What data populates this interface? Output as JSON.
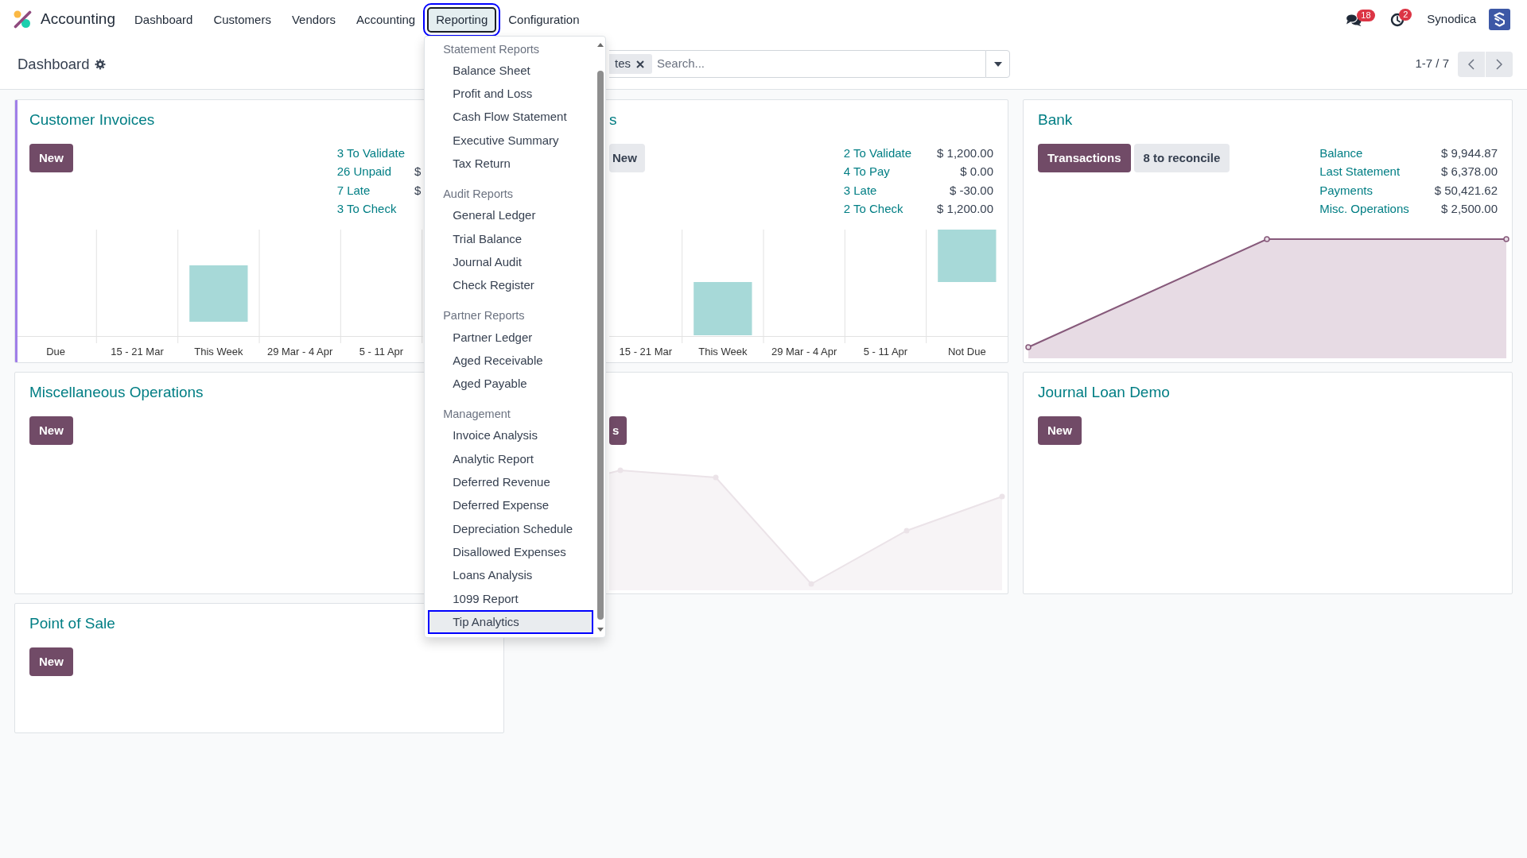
{
  "navbar": {
    "app_name": "Accounting",
    "menu": [
      {
        "label": "Dashboard",
        "selected": false
      },
      {
        "label": "Customers",
        "selected": false
      },
      {
        "label": "Vendors",
        "selected": false
      },
      {
        "label": "Accounting",
        "selected": false
      },
      {
        "label": "Reporting",
        "selected": true,
        "dropdown": {
          "sections": [
            {
              "header": "Statement Reports",
              "items": [
                {
                  "label": "Balance Sheet",
                  "selected": false
                },
                {
                  "label": "Profit and Loss",
                  "selected": false
                },
                {
                  "label": "Cash Flow Statement",
                  "selected": false
                },
                {
                  "label": "Executive Summary",
                  "selected": false
                },
                {
                  "label": "Tax Return",
                  "selected": false
                }
              ]
            },
            {
              "header": "Audit Reports",
              "items": [
                {
                  "label": "General Ledger",
                  "selected": false
                },
                {
                  "label": "Trial Balance",
                  "selected": false
                },
                {
                  "label": "Journal Audit",
                  "selected": false
                },
                {
                  "label": "Check Register",
                  "selected": false
                }
              ]
            },
            {
              "header": "Partner Reports",
              "items": [
                {
                  "label": "Partner Ledger",
                  "selected": false
                },
                {
                  "label": "Aged Receivable",
                  "selected": false
                },
                {
                  "label": "Aged Payable",
                  "selected": false
                }
              ]
            },
            {
              "header": "Management",
              "items": [
                {
                  "label": "Invoice Analysis",
                  "selected": false
                },
                {
                  "label": "Analytic Report",
                  "selected": false
                },
                {
                  "label": "Deferred Revenue",
                  "selected": false
                },
                {
                  "label": "Deferred Expense",
                  "selected": false
                },
                {
                  "label": "Depreciation Schedule",
                  "selected": false
                },
                {
                  "label": "Disallowed Expenses",
                  "selected": false
                },
                {
                  "label": "Loans Analysis",
                  "selected": false
                },
                {
                  "label": "1099 Report",
                  "selected": false
                },
                {
                  "label": "Tip Analytics",
                  "selected": true
                }
              ]
            }
          ]
        }
      },
      {
        "label": "Configuration",
        "selected": false
      }
    ],
    "messages_count": "18",
    "activities_count": "2",
    "company": "Synodica"
  },
  "control_panel": {
    "breadcrumb": "Dashboard",
    "search": {
      "facet": "tes",
      "placeholder": "Search..."
    },
    "pager": "1-7 / 7"
  },
  "cards": [
    {
      "title": "Customer Invoices",
      "color": "#a07ee8",
      "buttons": [
        {
          "label": "New",
          "kind": "primary"
        }
      ],
      "stats": [
        {
          "label": "3 To Validate"
        },
        {
          "label": "26 Unpaid",
          "amount": "$"
        },
        {
          "label": "7 Late",
          "amount": "$"
        },
        {
          "label": "3 To Check"
        }
      ],
      "graph": {
        "kind": "bar",
        "labels": [
          "Due",
          "15 - 21 Mar",
          "This Week",
          "29 Mar - 4 Apr",
          "5 - 11 Apr"
        ]
      }
    },
    {
      "title": "s",
      "buttons": [
        {
          "label": "New",
          "kind": "secondary"
        }
      ],
      "stats": [
        {
          "label": "2 To Validate",
          "amount": "$ 1,200.00"
        },
        {
          "label": "4 To Pay",
          "amount": "$ 0.00"
        },
        {
          "label": "3 Late",
          "amount": "$ -30.00"
        },
        {
          "label": "2 To Check",
          "amount": "$ 1,200.00"
        }
      ],
      "graph": {
        "kind": "bar",
        "labels": [
          "15 - 21 Mar",
          "This Week",
          "29 Mar - 4 Apr",
          "5 - 11 Apr",
          "Not Due"
        ]
      }
    },
    {
      "title": "Bank",
      "buttons": [
        {
          "label": "Transactions",
          "kind": "primary"
        },
        {
          "label": "8 to reconcile",
          "kind": "secondary"
        }
      ],
      "stats": [
        {
          "label": "Balance",
          "amount": "$ 9,944.87"
        },
        {
          "label": "Last Statement",
          "amount": "$ 6,378.00"
        },
        {
          "label": "Payments",
          "amount": "$ 50,421.62"
        },
        {
          "label": "Misc. Operations",
          "amount": "$ 2,500.00"
        }
      ],
      "graph": {
        "kind": "line"
      }
    },
    {
      "title": "Miscellaneous Operations",
      "buttons": [
        {
          "label": "New",
          "kind": "primary"
        }
      ]
    },
    {
      "buttons": [
        {
          "label": "s",
          "kind": "primary"
        }
      ],
      "graph": {
        "kind": "sample"
      }
    },
    {
      "title": "Journal Loan Demo",
      "buttons": [
        {
          "label": "New",
          "kind": "primary"
        }
      ]
    },
    {
      "title": "Point of Sale",
      "buttons": [
        {
          "label": "New",
          "kind": "primary"
        }
      ]
    }
  ]
}
